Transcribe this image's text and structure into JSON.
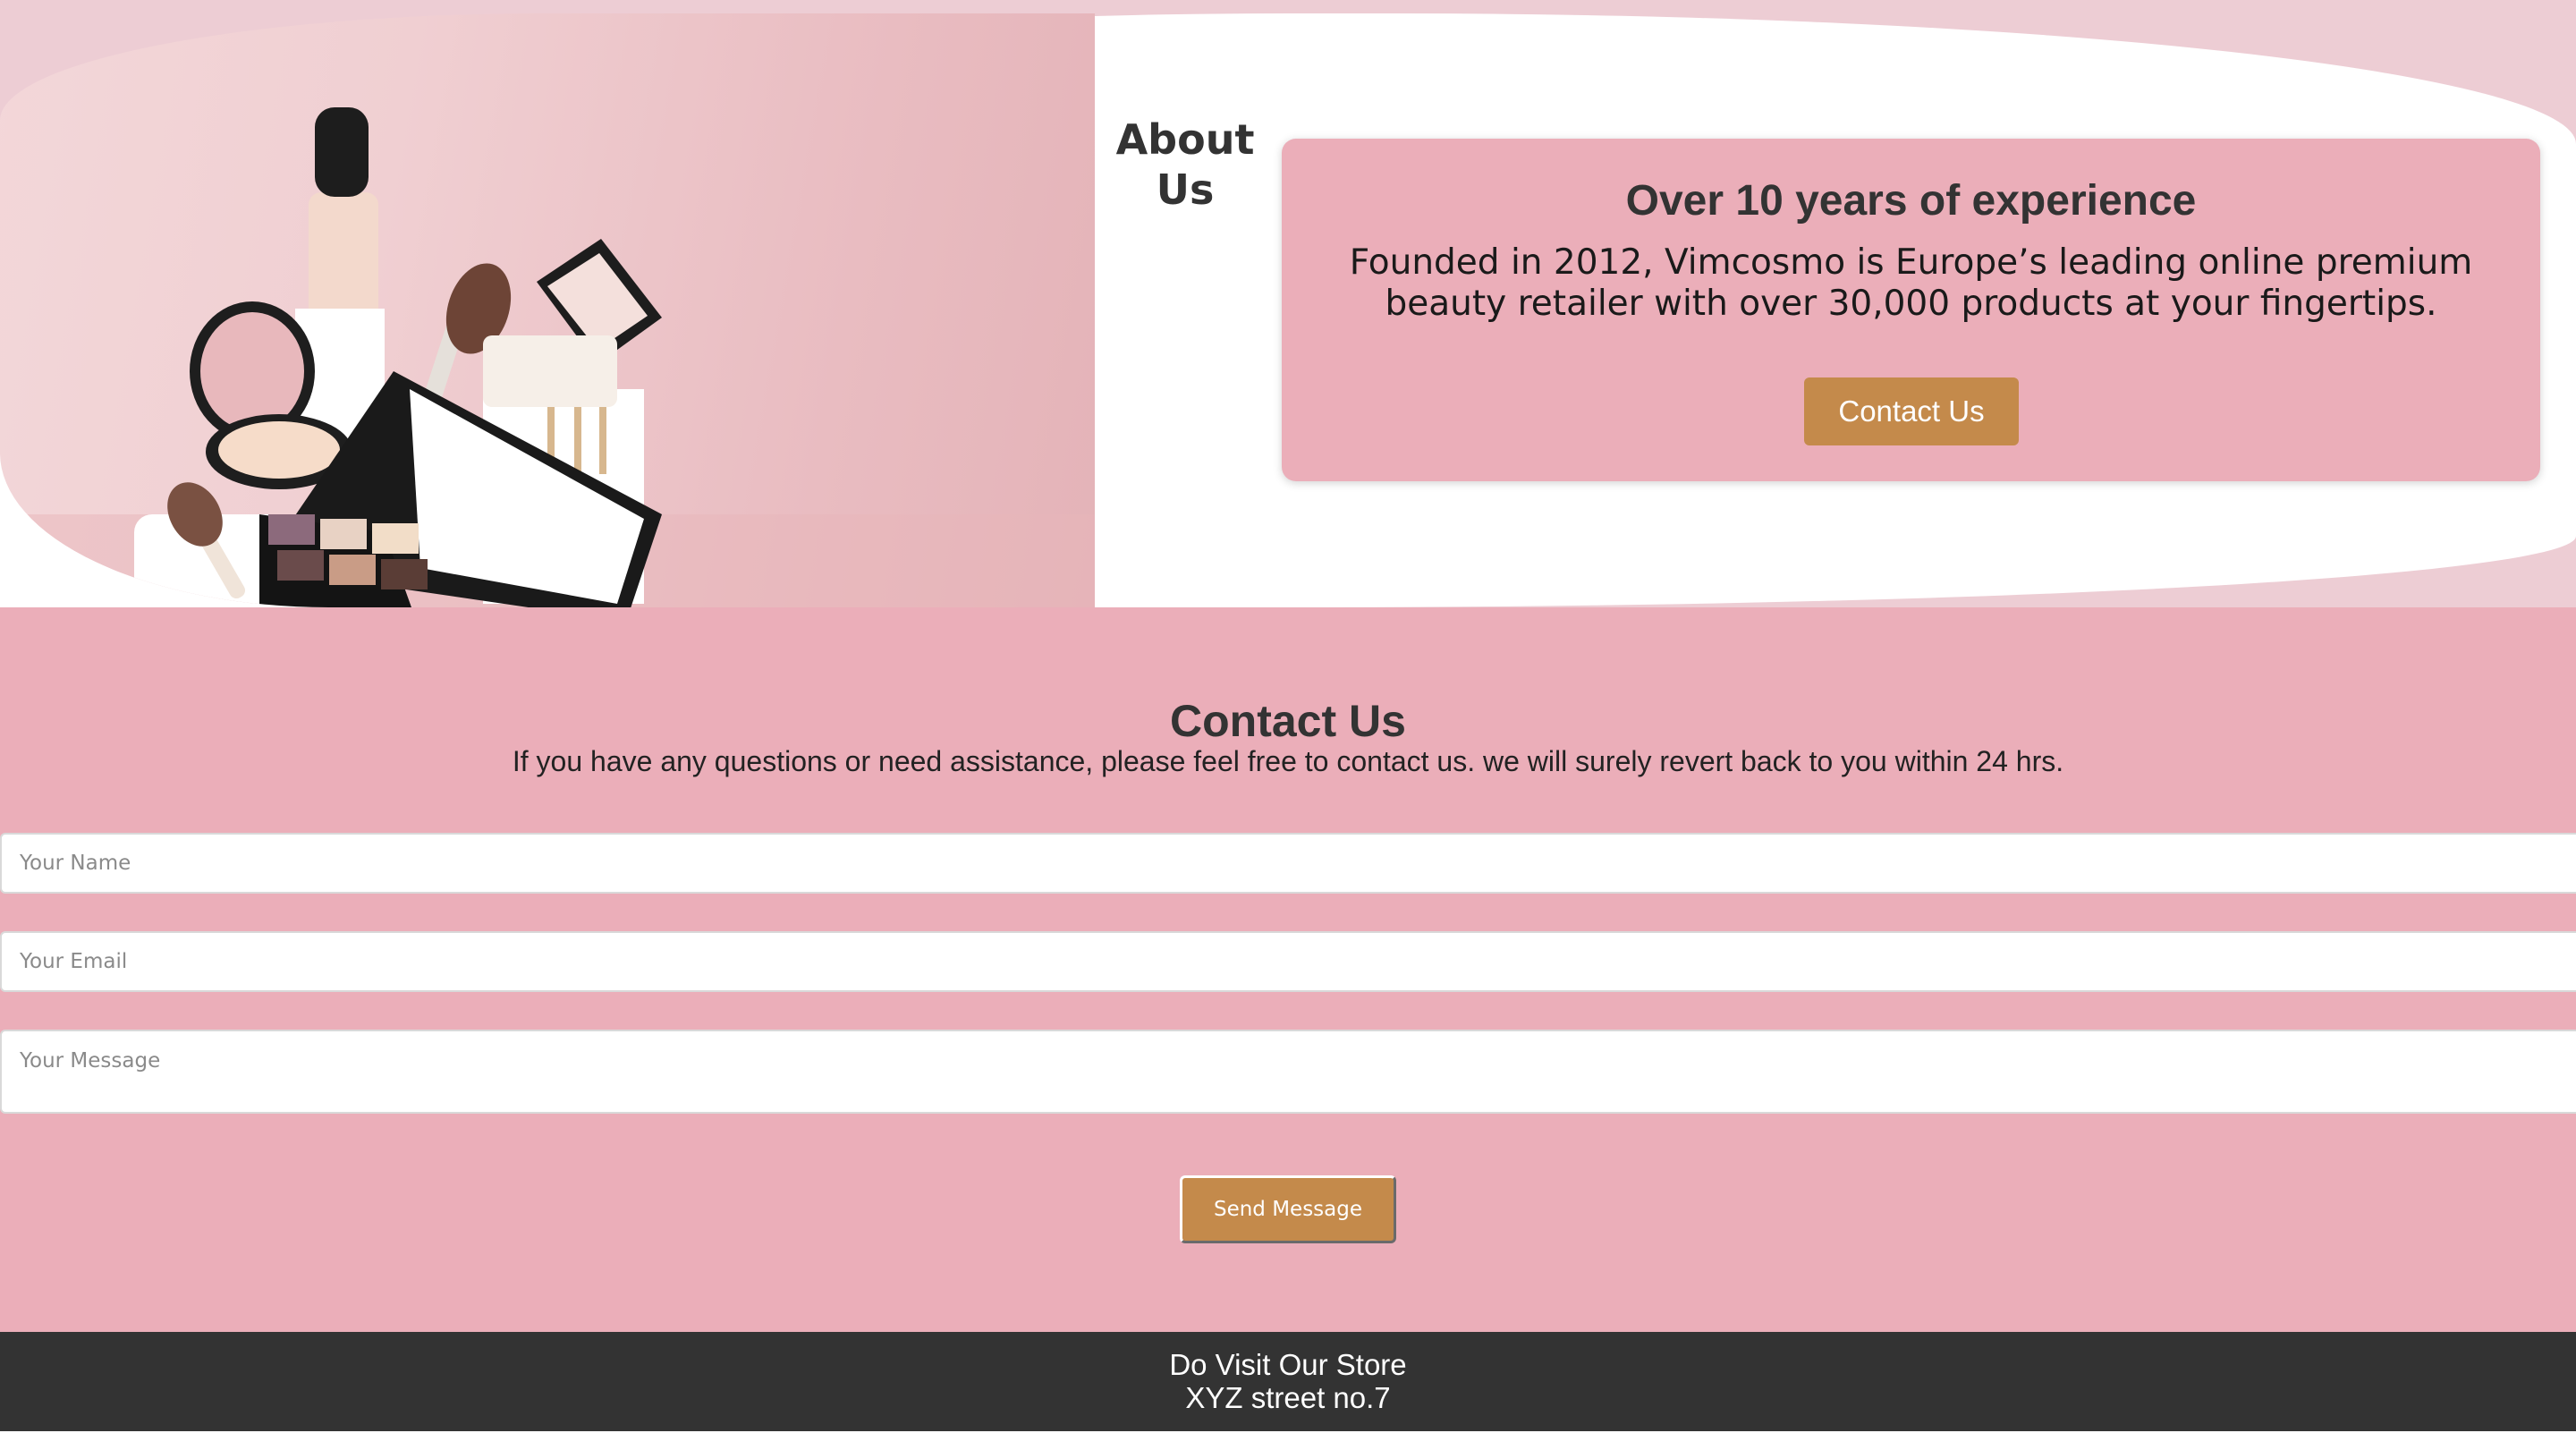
{
  "about": {
    "title": "About Us",
    "card_heading": "Over 10 years of experience",
    "card_text": "Founded in 2012, Vimcosmo is Europe’s leading online premium beauty retailer with over 30,000 products at your fingertips.",
    "button_label": "Contact Us"
  },
  "contact": {
    "title": "Contact Us",
    "intro": "If you have any questions or need assistance, please feel free to contact us. we will surely revert back to you within 24 hrs.",
    "name_placeholder": "Your Name",
    "email_placeholder": "Your Email",
    "message_placeholder": "Your Message",
    "send_label": "Send Message"
  },
  "footer": {
    "line1": "Do Visit Our Store",
    "line2": "XYZ street no.7"
  },
  "colors": {
    "hero_background": "#edcdd4",
    "section_pink": "#ebaeb9",
    "button_gold": "#c48a4b",
    "footer_dark": "#333333"
  },
  "icons": {
    "hero_image": "cosmetics-products-image"
  }
}
